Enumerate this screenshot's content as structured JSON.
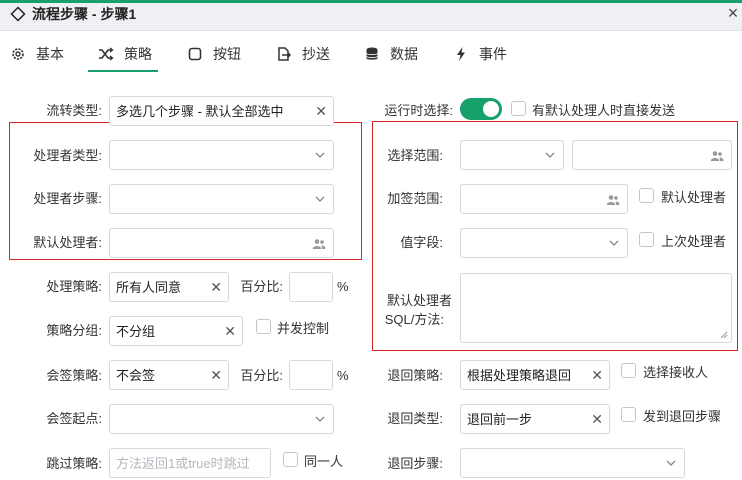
{
  "window": {
    "title": "流程步骤 - 步骤1"
  },
  "tabs": [
    {
      "label": "基本",
      "icon": "gear-icon"
    },
    {
      "label": "策略",
      "icon": "shuffle-icon"
    },
    {
      "label": "按钮",
      "icon": "square-icon"
    },
    {
      "label": "抄送",
      "icon": "share-icon"
    },
    {
      "label": "数据",
      "icon": "database-icon"
    },
    {
      "label": "事件",
      "icon": "bolt-icon"
    }
  ],
  "active_tab": "策略",
  "accent_color": "#18a06b",
  "highlight_color": "#d9262b",
  "left": {
    "flow_type": {
      "label": "流转类型:",
      "value": "多选几个步骤 - 默认全部选中"
    },
    "handler_type": {
      "label": "处理者类型:",
      "value": ""
    },
    "handler_step": {
      "label": "处理者步骤:",
      "value": ""
    },
    "default_handler": {
      "label": "默认处理者:",
      "value": ""
    },
    "handle_strategy": {
      "label": "处理策略:",
      "value": "所有人同意",
      "percent_label": "百分比:",
      "percent_value": "",
      "percent_unit": "%"
    },
    "strategy_group": {
      "label": "策略分组:",
      "value": "不分组",
      "checkbox": "并发控制"
    },
    "countersign_strategy": {
      "label": "会签策略:",
      "value": "不会签",
      "percent_label": "百分比:",
      "percent_value": "",
      "percent_unit": "%"
    },
    "countersign_start": {
      "label": "会签起点:",
      "value": ""
    },
    "skip_strategy": {
      "label": "跳过策略:",
      "placeholder": "方法返回1或true时跳过",
      "checkbox": "同一人"
    }
  },
  "right": {
    "runtime_select": {
      "label": "运行时选择:",
      "toggle_on": true,
      "checkbox": "有默认处理人时直接发送"
    },
    "select_range": {
      "label": "选择范围:",
      "value": "",
      "value2": ""
    },
    "countersign_range": {
      "label": "加签范围:",
      "value": "",
      "checkbox": "默认处理者"
    },
    "value_field": {
      "label": "值字段:",
      "value": "",
      "checkbox": "上次处理者"
    },
    "default_handler_sql": {
      "label_line1": "默认处理者",
      "label_line2": "SQL/方法:",
      "value": ""
    },
    "return_strategy": {
      "label": "退回策略:",
      "value": "根据处理策略退回",
      "checkbox": "选择接收人"
    },
    "return_type": {
      "label": "退回类型:",
      "value": "退回前一步",
      "checkbox": "发到退回步骤"
    },
    "return_step": {
      "label": "退回步骤:",
      "value": ""
    }
  }
}
